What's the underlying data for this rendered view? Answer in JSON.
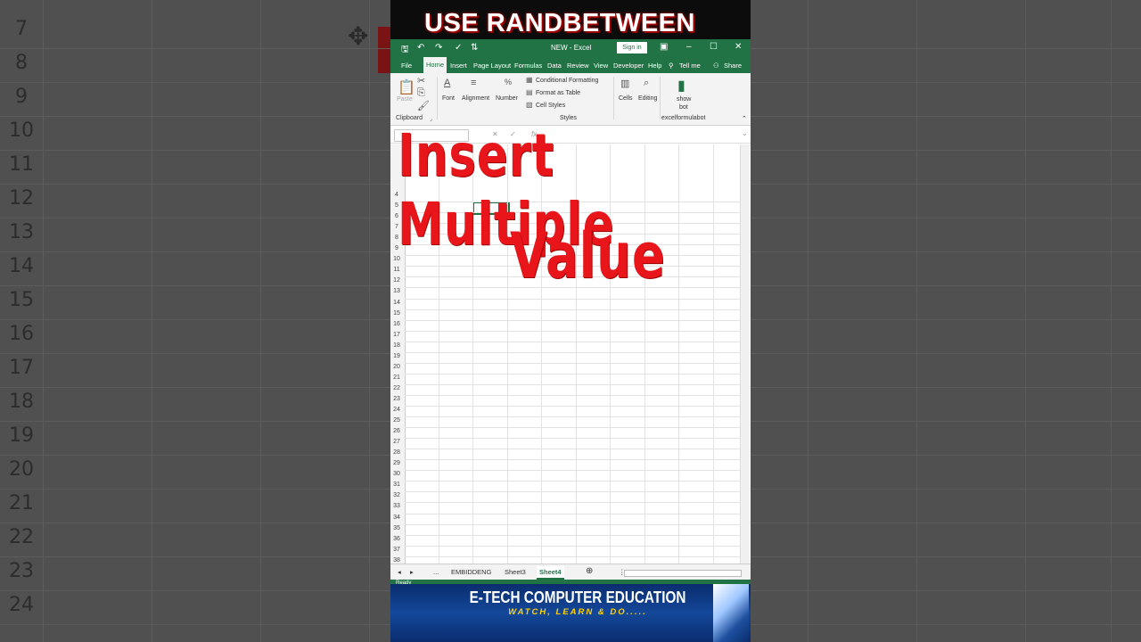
{
  "banner_top": "USE RANDBETWEEN",
  "excel": {
    "window_title": "NEW  -  Excel",
    "sign_in": "Sign in",
    "menu": [
      "File",
      "Home",
      "Insert",
      "Page Layout",
      "Formulas",
      "Data",
      "Review",
      "View",
      "Developer",
      "Help",
      "Tell me",
      "Share"
    ],
    "ribbon": {
      "clipboard_group": "Clipboard",
      "paste": "Paste",
      "font": "Font",
      "alignment": "Alignment",
      "number": "Number",
      "conditional_formatting": "Conditional Formatting",
      "format_as_table": "Format as Table",
      "cell_styles": "Cell Styles",
      "styles_group": "Styles",
      "cells": "Cells",
      "editing": "Editing",
      "show_bot_line1": "show",
      "show_bot_line2": "bot",
      "excelformulabot_group": "excelformulabot"
    },
    "fx_label": "fx",
    "row_numbers": [
      "4",
      "5",
      "6",
      "7",
      "8",
      "9",
      "10",
      "11",
      "12",
      "13",
      "14",
      "15",
      "16",
      "17",
      "18",
      "19",
      "20",
      "21",
      "22",
      "23",
      "24",
      "25",
      "26",
      "27",
      "28",
      "29",
      "30",
      "31",
      "32",
      "33",
      "34",
      "35",
      "36",
      "37",
      "38"
    ],
    "sheet_tabs": [
      "EMBIDDENG",
      "Sheet3",
      "Sheet4"
    ],
    "active_sheet": "Sheet4",
    "ellipsis": "...",
    "status": "Ready"
  },
  "overlay": {
    "line1": "Insert Multiple",
    "line2": "Value"
  },
  "banner_bottom": {
    "title": "E-TECH COMPUTER EDUCATION",
    "subtitle": "WATCH, LEARN & DO....."
  },
  "background_row_numbers": [
    "7",
    "8",
    "9",
    "10",
    "11",
    "12",
    "13",
    "14",
    "15",
    "16",
    "17",
    "18",
    "19",
    "20",
    "21",
    "22",
    "23",
    "24"
  ],
  "colors": {
    "excel_green": "#217346",
    "overlay_red": "#e8151b",
    "banner_blue": "#0a2d6e"
  }
}
